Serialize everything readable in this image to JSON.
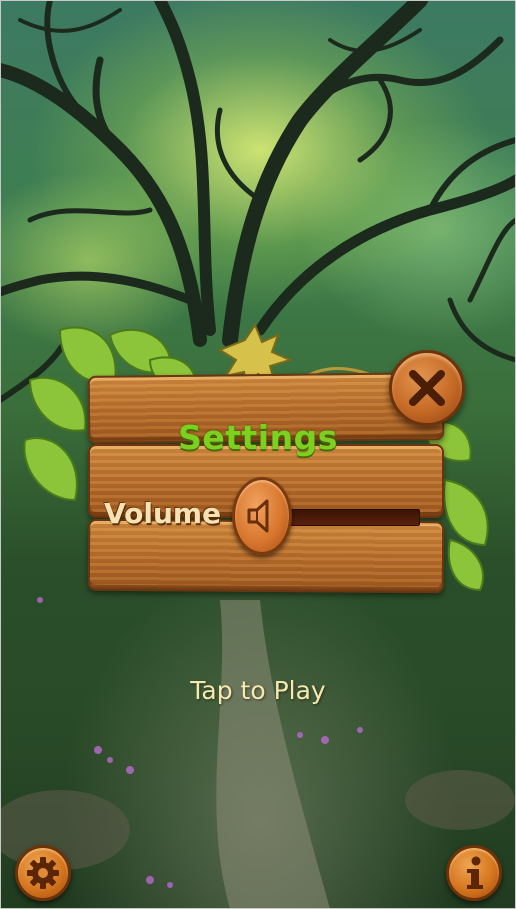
{
  "settings_dialog": {
    "title": "Settings",
    "volume_label": "Volume",
    "volume_level": 0.05,
    "speaker_icon": "speaker-mute-icon",
    "close_icon": "close-x-icon"
  },
  "main": {
    "tap_to_play": "Tap to Play"
  },
  "corner_buttons": {
    "settings_icon": "gear-icon",
    "info_icon": "info-icon"
  },
  "colors": {
    "title_green": "#7cd11e",
    "wood": "#b86c2a",
    "label_cream": "#f6e3b4"
  }
}
